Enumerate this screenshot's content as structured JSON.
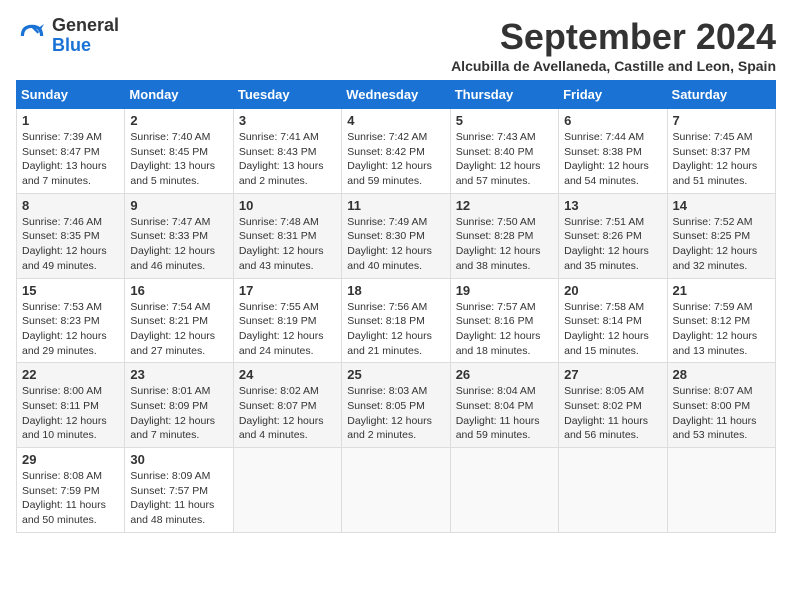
{
  "header": {
    "logo_general": "General",
    "logo_blue": "Blue",
    "month_title": "September 2024",
    "subtitle": "Alcubilla de Avellaneda, Castille and Leon, Spain"
  },
  "days_of_week": [
    "Sunday",
    "Monday",
    "Tuesday",
    "Wednesday",
    "Thursday",
    "Friday",
    "Saturday"
  ],
  "weeks": [
    [
      {
        "day": "1",
        "sunrise": "Sunrise: 7:39 AM",
        "sunset": "Sunset: 8:47 PM",
        "daylight": "Daylight: 13 hours and 7 minutes."
      },
      {
        "day": "2",
        "sunrise": "Sunrise: 7:40 AM",
        "sunset": "Sunset: 8:45 PM",
        "daylight": "Daylight: 13 hours and 5 minutes."
      },
      {
        "day": "3",
        "sunrise": "Sunrise: 7:41 AM",
        "sunset": "Sunset: 8:43 PM",
        "daylight": "Daylight: 13 hours and 2 minutes."
      },
      {
        "day": "4",
        "sunrise": "Sunrise: 7:42 AM",
        "sunset": "Sunset: 8:42 PM",
        "daylight": "Daylight: 12 hours and 59 minutes."
      },
      {
        "day": "5",
        "sunrise": "Sunrise: 7:43 AM",
        "sunset": "Sunset: 8:40 PM",
        "daylight": "Daylight: 12 hours and 57 minutes."
      },
      {
        "day": "6",
        "sunrise": "Sunrise: 7:44 AM",
        "sunset": "Sunset: 8:38 PM",
        "daylight": "Daylight: 12 hours and 54 minutes."
      },
      {
        "day": "7",
        "sunrise": "Sunrise: 7:45 AM",
        "sunset": "Sunset: 8:37 PM",
        "daylight": "Daylight: 12 hours and 51 minutes."
      }
    ],
    [
      {
        "day": "8",
        "sunrise": "Sunrise: 7:46 AM",
        "sunset": "Sunset: 8:35 PM",
        "daylight": "Daylight: 12 hours and 49 minutes."
      },
      {
        "day": "9",
        "sunrise": "Sunrise: 7:47 AM",
        "sunset": "Sunset: 8:33 PM",
        "daylight": "Daylight: 12 hours and 46 minutes."
      },
      {
        "day": "10",
        "sunrise": "Sunrise: 7:48 AM",
        "sunset": "Sunset: 8:31 PM",
        "daylight": "Daylight: 12 hours and 43 minutes."
      },
      {
        "day": "11",
        "sunrise": "Sunrise: 7:49 AM",
        "sunset": "Sunset: 8:30 PM",
        "daylight": "Daylight: 12 hours and 40 minutes."
      },
      {
        "day": "12",
        "sunrise": "Sunrise: 7:50 AM",
        "sunset": "Sunset: 8:28 PM",
        "daylight": "Daylight: 12 hours and 38 minutes."
      },
      {
        "day": "13",
        "sunrise": "Sunrise: 7:51 AM",
        "sunset": "Sunset: 8:26 PM",
        "daylight": "Daylight: 12 hours and 35 minutes."
      },
      {
        "day": "14",
        "sunrise": "Sunrise: 7:52 AM",
        "sunset": "Sunset: 8:25 PM",
        "daylight": "Daylight: 12 hours and 32 minutes."
      }
    ],
    [
      {
        "day": "15",
        "sunrise": "Sunrise: 7:53 AM",
        "sunset": "Sunset: 8:23 PM",
        "daylight": "Daylight: 12 hours and 29 minutes."
      },
      {
        "day": "16",
        "sunrise": "Sunrise: 7:54 AM",
        "sunset": "Sunset: 8:21 PM",
        "daylight": "Daylight: 12 hours and 27 minutes."
      },
      {
        "day": "17",
        "sunrise": "Sunrise: 7:55 AM",
        "sunset": "Sunset: 8:19 PM",
        "daylight": "Daylight: 12 hours and 24 minutes."
      },
      {
        "day": "18",
        "sunrise": "Sunrise: 7:56 AM",
        "sunset": "Sunset: 8:18 PM",
        "daylight": "Daylight: 12 hours and 21 minutes."
      },
      {
        "day": "19",
        "sunrise": "Sunrise: 7:57 AM",
        "sunset": "Sunset: 8:16 PM",
        "daylight": "Daylight: 12 hours and 18 minutes."
      },
      {
        "day": "20",
        "sunrise": "Sunrise: 7:58 AM",
        "sunset": "Sunset: 8:14 PM",
        "daylight": "Daylight: 12 hours and 15 minutes."
      },
      {
        "day": "21",
        "sunrise": "Sunrise: 7:59 AM",
        "sunset": "Sunset: 8:12 PM",
        "daylight": "Daylight: 12 hours and 13 minutes."
      }
    ],
    [
      {
        "day": "22",
        "sunrise": "Sunrise: 8:00 AM",
        "sunset": "Sunset: 8:11 PM",
        "daylight": "Daylight: 12 hours and 10 minutes."
      },
      {
        "day": "23",
        "sunrise": "Sunrise: 8:01 AM",
        "sunset": "Sunset: 8:09 PM",
        "daylight": "Daylight: 12 hours and 7 minutes."
      },
      {
        "day": "24",
        "sunrise": "Sunrise: 8:02 AM",
        "sunset": "Sunset: 8:07 PM",
        "daylight": "Daylight: 12 hours and 4 minutes."
      },
      {
        "day": "25",
        "sunrise": "Sunrise: 8:03 AM",
        "sunset": "Sunset: 8:05 PM",
        "daylight": "Daylight: 12 hours and 2 minutes."
      },
      {
        "day": "26",
        "sunrise": "Sunrise: 8:04 AM",
        "sunset": "Sunset: 8:04 PM",
        "daylight": "Daylight: 11 hours and 59 minutes."
      },
      {
        "day": "27",
        "sunrise": "Sunrise: 8:05 AM",
        "sunset": "Sunset: 8:02 PM",
        "daylight": "Daylight: 11 hours and 56 minutes."
      },
      {
        "day": "28",
        "sunrise": "Sunrise: 8:07 AM",
        "sunset": "Sunset: 8:00 PM",
        "daylight": "Daylight: 11 hours and 53 minutes."
      }
    ],
    [
      {
        "day": "29",
        "sunrise": "Sunrise: 8:08 AM",
        "sunset": "Sunset: 7:59 PM",
        "daylight": "Daylight: 11 hours and 50 minutes."
      },
      {
        "day": "30",
        "sunrise": "Sunrise: 8:09 AM",
        "sunset": "Sunset: 7:57 PM",
        "daylight": "Daylight: 11 hours and 48 minutes."
      },
      {
        "day": "",
        "sunrise": "",
        "sunset": "",
        "daylight": ""
      },
      {
        "day": "",
        "sunrise": "",
        "sunset": "",
        "daylight": ""
      },
      {
        "day": "",
        "sunrise": "",
        "sunset": "",
        "daylight": ""
      },
      {
        "day": "",
        "sunrise": "",
        "sunset": "",
        "daylight": ""
      },
      {
        "day": "",
        "sunrise": "",
        "sunset": "",
        "daylight": ""
      }
    ]
  ]
}
